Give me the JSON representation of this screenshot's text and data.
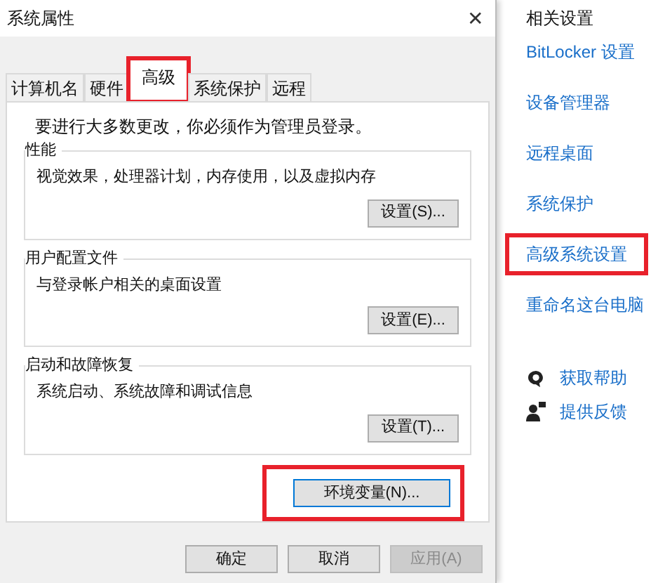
{
  "window": {
    "title": "系统属性",
    "close": "✕"
  },
  "tabs": [
    {
      "label": "计算机名",
      "selected": false,
      "highlighted": false
    },
    {
      "label": "硬件",
      "selected": false,
      "highlighted": false
    },
    {
      "label": "高级",
      "selected": true,
      "highlighted": true
    },
    {
      "label": "系统保护",
      "selected": false,
      "highlighted": false
    },
    {
      "label": "远程",
      "selected": false,
      "highlighted": false
    }
  ],
  "notice": "要进行大多数更改，你必须作为管理员登录。",
  "groups": [
    {
      "title": "性能",
      "description": "视觉效果，处理器计划，内存使用，以及虚拟内存",
      "button": "设置(S)..."
    },
    {
      "title": "用户配置文件",
      "description": "与登录帐户相关的桌面设置",
      "button": "设置(E)..."
    },
    {
      "title": "启动和故障恢复",
      "description": "系统启动、系统故障和调试信息",
      "button": "设置(T)..."
    }
  ],
  "env_button": {
    "label": "环境变量(N)...",
    "highlighted": true
  },
  "footer_buttons": [
    {
      "label": "确定",
      "disabled": false
    },
    {
      "label": "取消",
      "disabled": false
    },
    {
      "label": "应用(A)",
      "disabled": true
    }
  ],
  "related": {
    "heading": "相关设置",
    "links": [
      {
        "label": "BitLocker 设置",
        "highlighted": false
      },
      {
        "label": "设备管理器",
        "highlighted": false
      },
      {
        "label": "远程桌面",
        "highlighted": false
      },
      {
        "label": "系统保护",
        "highlighted": false
      },
      {
        "label": "高级系统设置",
        "highlighted": true
      },
      {
        "label": "重命名这台电脑",
        "highlighted": false
      }
    ]
  },
  "help": [
    {
      "kind": "help",
      "label": "获取帮助"
    },
    {
      "kind": "feedback",
      "label": "提供反馈"
    }
  ]
}
